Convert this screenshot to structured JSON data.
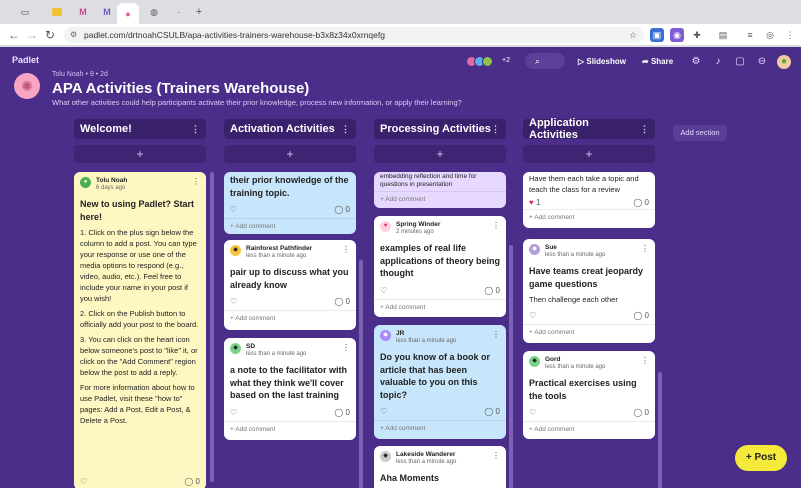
{
  "browser": {
    "url": "padlet.com/drtnoahCSULB/apa-activities-trainers-warehouse-b3x8z34x0xrnqefg"
  },
  "padlet": {
    "brand": "Padlet",
    "owner_meta": "Tolu Noah • 9 • 2d",
    "title": "APA Activities (Trainers Warehouse)",
    "subtitle": "What other activities could help participants activate their prior knowledge, process new information, or apply their learning?",
    "collab_count": "+2",
    "slideshow_label": "Slideshow",
    "share_label": "Share",
    "add_section_label": "Add section",
    "post_button_label": "Post"
  },
  "columns": [
    {
      "title": "Welcome!"
    },
    {
      "title": "Activation Activities"
    },
    {
      "title": "Processing Activities"
    },
    {
      "title": "Application Activities"
    }
  ],
  "cards": {
    "welcome": {
      "author": "Tolu Noah",
      "time": "6 days ago",
      "title": "New to using Padlet? Start here!",
      "p1": "1. Click on the plus sign below the column to add a post. You can type your response or use one of the media options to respond (e.g., video, audio, etc.). Feel free to include your name in your post if you wish!",
      "p2": "2. Click on the Publish button to officially add your post to the board.",
      "p3": "3. You can click on the heart icon below someone's post to \"like\" it, or click on the \"Add Comment\" region below the post to add a reply.",
      "p4": "For more information about how to use Padlet, visit these \"how to\" pages: Add a Post, Edit a Post, & Delete a Post.",
      "comments": "0"
    },
    "act1": {
      "title": "their prior knowledge of the training topic.",
      "comments": "0",
      "add_comment": "Add comment"
    },
    "act2": {
      "author": "Rainforest Pathfinder",
      "time": "less than a minute ago",
      "title": "pair up to discuss what you already know",
      "comments": "0",
      "add_comment": "Add comment"
    },
    "act3": {
      "author": "SD",
      "time": "less than a minute ago",
      "title": "a note to the facilitator with what they think we'll cover based on the last training",
      "comments": "0",
      "add_comment": "Add comment"
    },
    "proc1": {
      "body": "embedding reflection and time for questions in presentation",
      "add_comment": "Add comment"
    },
    "proc2": {
      "author": "Spring Winder",
      "time": "2 minutes ago",
      "title": "examples of real life applications of theory being thought",
      "comments": "0",
      "add_comment": "Add comment"
    },
    "proc3": {
      "author": "JR",
      "time": "less than a minute ago",
      "title": "Do you know of a book or article that has been valuable to you on this topic?",
      "comments": "0",
      "add_comment": "Add comment"
    },
    "proc4": {
      "author": "Lakeside Wanderer",
      "time": "less than a minute ago",
      "title": "Aha Moments"
    },
    "app1": {
      "body": "Have them each take a topic and teach the class for a review",
      "likes": "1",
      "comments": "0",
      "add_comment": "Add comment"
    },
    "app2": {
      "author": "Sue",
      "time": "less than a minute ago",
      "title": "Have teams creat jeopardy game questions",
      "body": "Then challenge each other",
      "comments": "0",
      "add_comment": "Add comment"
    },
    "app3": {
      "author": "Gord",
      "time": "less than a minute ago",
      "title": "Practical exercises using the tools",
      "comments": "0",
      "add_comment": "Add comment"
    }
  },
  "colors": {
    "board_bg": "#4b2d8a",
    "post_button": "#f5ea3a",
    "like_heart": "#d62f5a"
  }
}
